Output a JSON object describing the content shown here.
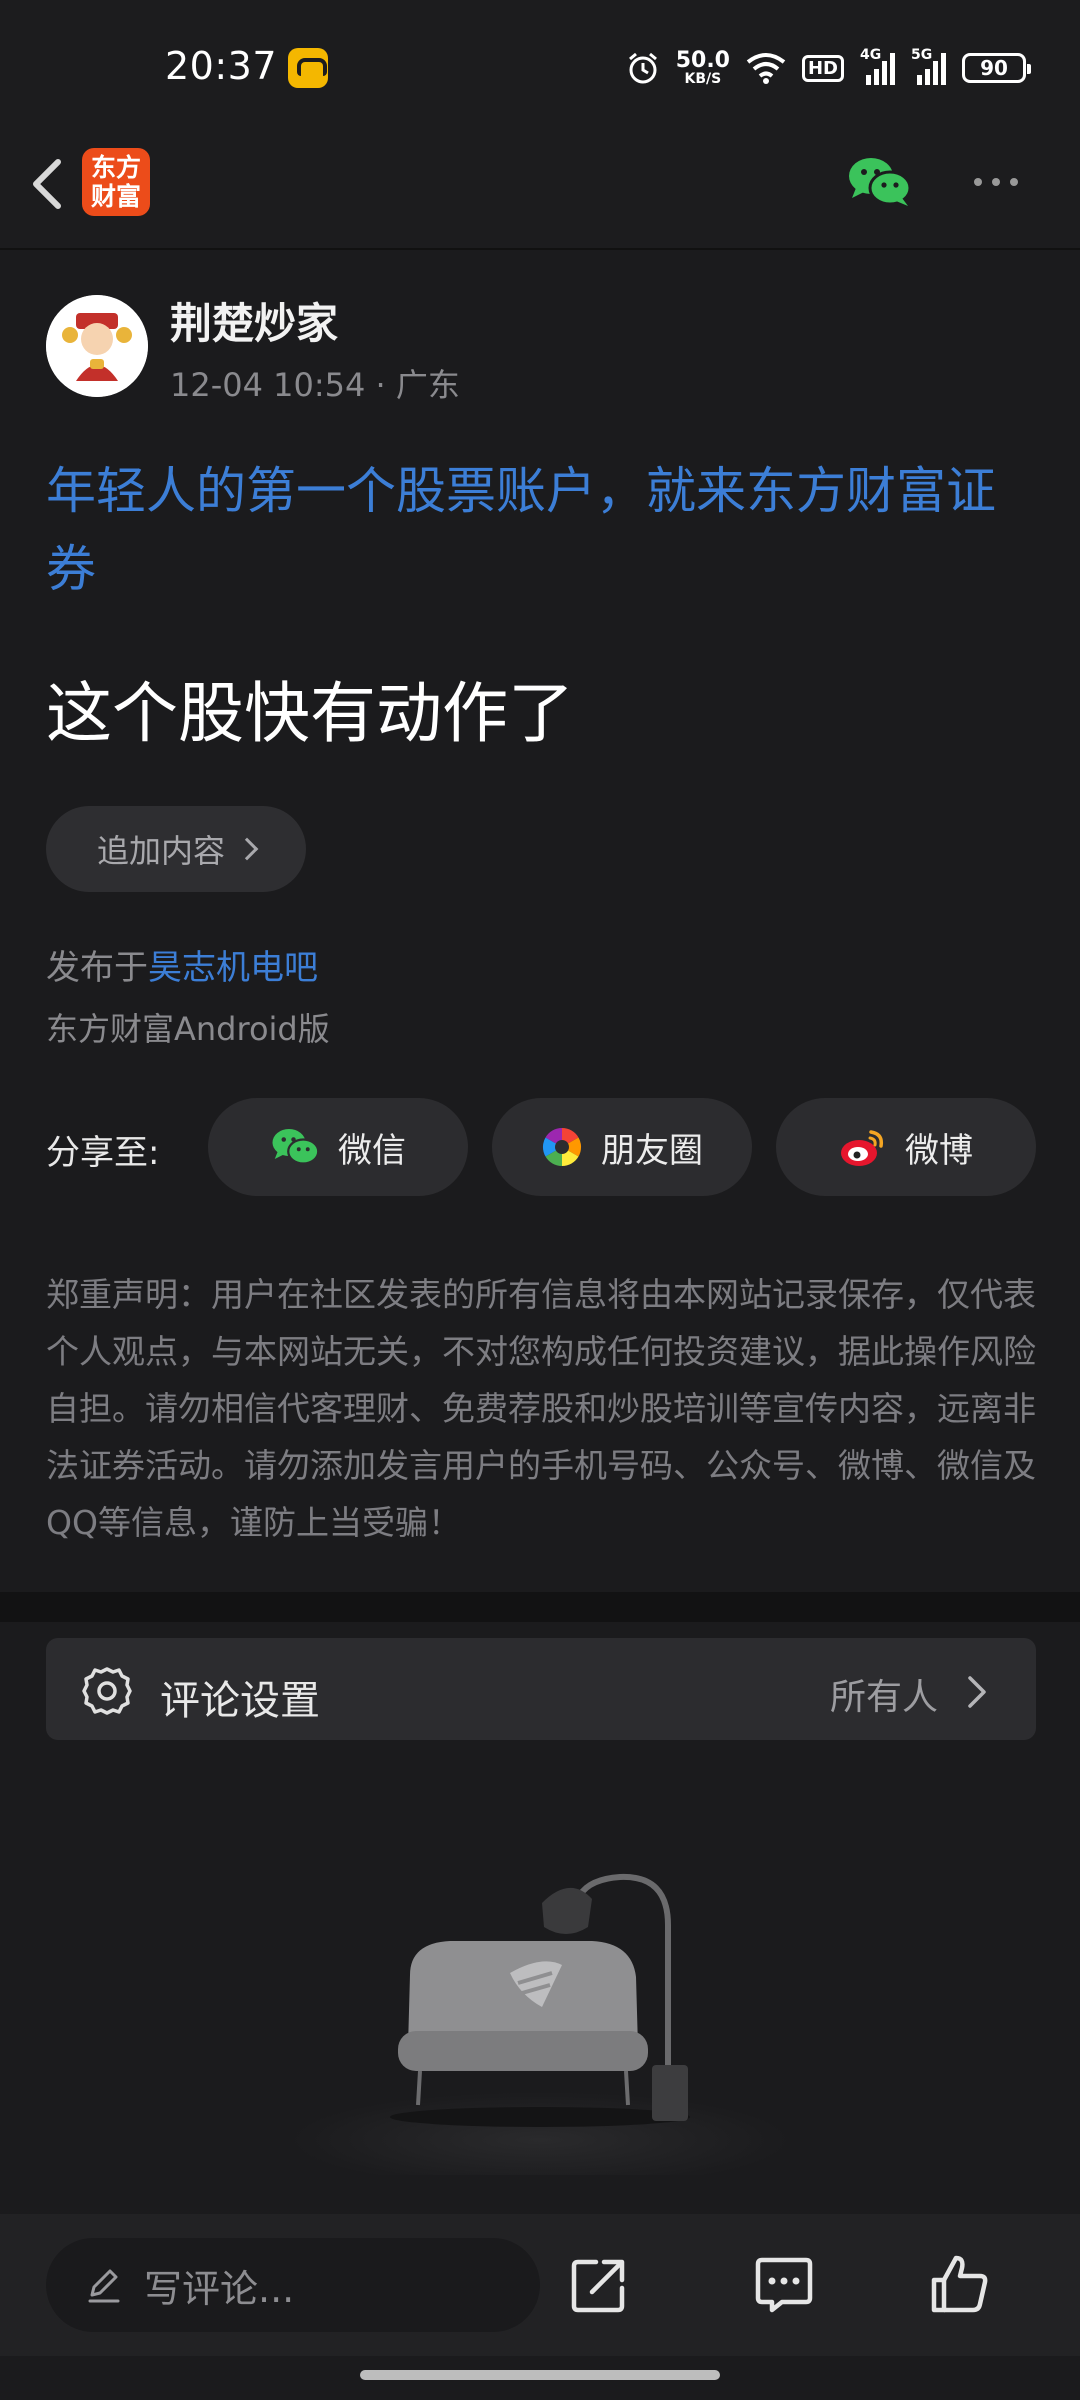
{
  "status_bar": {
    "time": "20:37",
    "net_speed_value": "50.0",
    "net_speed_unit": "KB/S",
    "hd_label": "HD",
    "signal_1_label": "4G",
    "signal_2_label": "5G",
    "battery": "90"
  },
  "nav": {
    "brand_logo_text": "东方财富",
    "icons": [
      "back-arrow-icon",
      "wechat-icon",
      "more-icon"
    ]
  },
  "post": {
    "author": "荆楚炒家",
    "date": "12-04 10:54",
    "location": "· 广东",
    "ad_text": "年轻人的第一个股票账户，就来东方财富证券",
    "title": "这个股快有动作了",
    "append_label": "追加内容",
    "published_prefix": "发布于",
    "bar_name": "昊志机电吧",
    "client": "东方财富Android版"
  },
  "share": {
    "label": "分享至:",
    "targets": [
      {
        "label": "微信",
        "icon": "wechat-icon"
      },
      {
        "label": "朋友圈",
        "icon": "moments-icon"
      },
      {
        "label": "微博",
        "icon": "weibo-icon"
      }
    ]
  },
  "disclaimer": "郑重声明：用户在社区发表的所有信息将由本网站记录保存，仅代表个人观点，与本网站无关，不对您构成任何投资建议，据此操作风险自担。请勿相信代客理财、免费荐股和炒股培训等宣传内容，远离非法证券活动。请勿添加发言用户的手机号码、公众号、微博、微信及QQ等信息，谨防上当受骗！",
  "comment_settings": {
    "label": "评论设置",
    "value": "所有人"
  },
  "bottom_bar": {
    "comment_placeholder": "写评论...",
    "icons": [
      "pencil-icon",
      "share-icon",
      "comment-icon",
      "like-icon"
    ]
  },
  "colors": {
    "background": "#1b1b1d",
    "link_blue": "#3c7ed6",
    "brand_orange": "#ec4c1a",
    "wechat_green": "#3bc35b",
    "weibo_red": "#e6162d"
  }
}
